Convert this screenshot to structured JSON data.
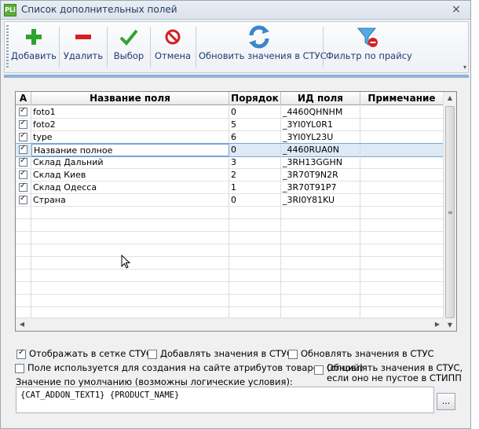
{
  "window": {
    "title": "Список дополнительных полей",
    "icon_text": "PLi",
    "close": "×"
  },
  "toolbar": {
    "add": "Добавить",
    "delete": "Удалить",
    "select": "Выбор",
    "cancel": "Отмена",
    "refresh": "Обновить значения в СТУС",
    "filter": "Фильтр по прайсу",
    "more": "▾"
  },
  "grid": {
    "columns": [
      "А",
      "Название поля",
      "Порядок",
      "ИД поля",
      "Примечание"
    ],
    "rows": [
      {
        "checked": true,
        "name": "foto1",
        "order": "0",
        "id": "_4460QHNHM",
        "note": ""
      },
      {
        "checked": true,
        "name": "foto2",
        "order": "5",
        "id": "_3YI0YL0R1",
        "note": ""
      },
      {
        "checked": true,
        "name": "type",
        "order": "6",
        "id": "_3YI0YL23U",
        "note": ""
      },
      {
        "checked": true,
        "name": "Название полное",
        "order": "0",
        "id": "_4460RUA0N",
        "note": "",
        "selected": true
      },
      {
        "checked": true,
        "name": "Склад Дальний",
        "order": "3",
        "id": "_3RH13GGHN",
        "note": ""
      },
      {
        "checked": true,
        "name": "Склад Киев",
        "order": "2",
        "id": "_3R70T9N2R",
        "note": ""
      },
      {
        "checked": true,
        "name": "Склад Одесса",
        "order": "1",
        "id": "_3R70T91P7",
        "note": ""
      },
      {
        "checked": true,
        "name": "Страна",
        "order": "0",
        "id": "_3RI0Y81KU",
        "note": ""
      }
    ],
    "empty_rows": 10,
    "scroll": {
      "up": "▲",
      "down": "▼",
      "left": "◀",
      "right": "▶",
      "grip": "≡"
    }
  },
  "options": {
    "show_in_grid": {
      "label": "Отображать в сетке СТУС",
      "checked": true
    },
    "add_values": {
      "label": "Добавлять значения в СТУС",
      "checked": false
    },
    "update_values": {
      "label": "Обновлять значения в СТУС",
      "checked": false
    },
    "used_for_site": {
      "label": "Поле используется для создания на сайте атрибутов товаров (опций)",
      "checked": false
    },
    "update_if_not_empty": {
      "label_line1": "Обновлять значения в СТУС,",
      "label_line2": "если оно не пустое в СТИПП",
      "checked": false
    }
  },
  "default_value": {
    "label": "Значение по умолчанию (возможны логические условия):",
    "value": "{CAT_ADDON_TEXT1} {PRODUCT_NAME}",
    "button": "..."
  },
  "colors": {
    "accent": "#1e3b73",
    "selection": "#dceaf7",
    "add_icon": "#2fa32f",
    "delete_icon": "#d62020",
    "refresh_icon": "#3b86c8"
  }
}
